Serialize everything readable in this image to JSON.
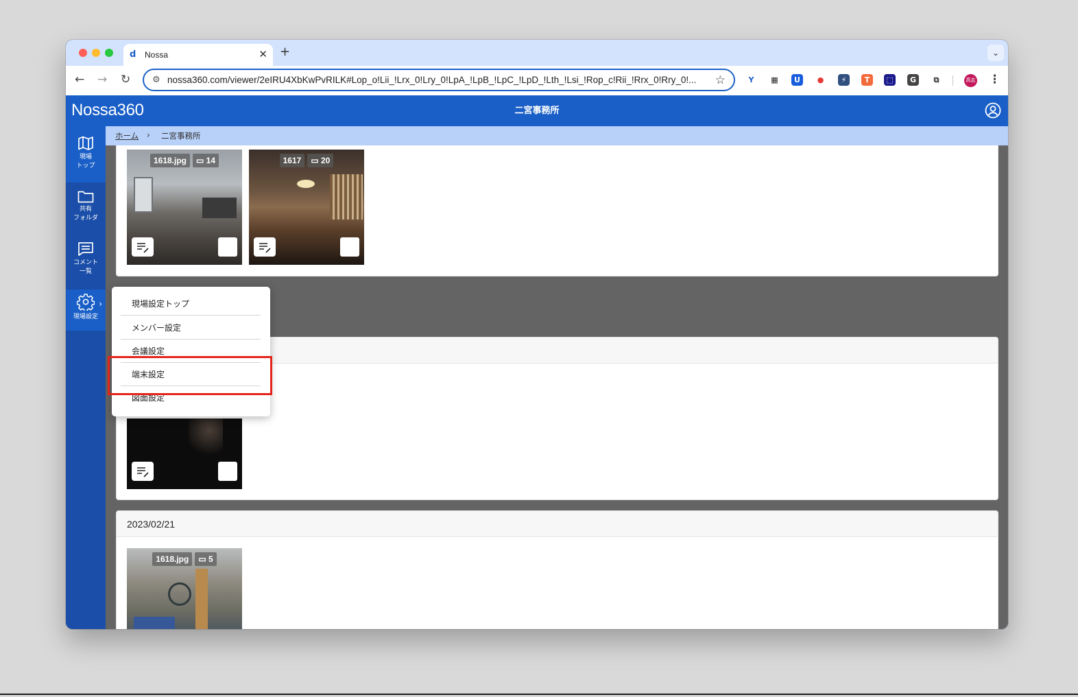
{
  "browser": {
    "tab_title": "Nossa",
    "tab_favicon": "d",
    "close_icon": "✕",
    "new_tab_icon": "+",
    "tab_dropdown_icon": "⌄",
    "back_icon": "←",
    "forward_icon": "→",
    "reload_icon": "↻",
    "site_info_icon": "⚙",
    "url": "nossa360.com/viewer/2eIRU4XbKwPvRILK#Lop_o!Lii_!Lrx_0!Lry_0!LpA_!LpB_!LpC_!LpD_!Lth_!Lsi_!Rop_c!Rii_!Rrx_0!Rry_0!...",
    "bookmark_icon": "☆",
    "profile_label": "高志",
    "menu_icon": "⋮",
    "extensions": [
      {
        "name": "y-extension-icon",
        "glyph": "Y",
        "color": "#1a5fc7",
        "bg": "#ffffff"
      },
      {
        "name": "qr-code-icon",
        "glyph": "▦",
        "color": "#222222",
        "bg": "#ffffff"
      },
      {
        "name": "bitwarden-icon",
        "glyph": "U",
        "color": "#ffffff",
        "bg": "#175ddc"
      },
      {
        "name": "record-icon",
        "glyph": "●",
        "color": "#e53935",
        "bg": "#ffffff"
      },
      {
        "name": "bolt-icon",
        "glyph": "⚡",
        "color": "#ffffff",
        "bg": "#2f4f7f"
      },
      {
        "name": "translate-icon",
        "glyph": "T",
        "color": "#ffffff",
        "bg": "#f26b3a"
      },
      {
        "name": "notion-like-icon",
        "glyph": "⬚",
        "color": "#ffffff",
        "bg": "#1a1a8c"
      },
      {
        "name": "g-extension-icon",
        "glyph": "G",
        "color": "#ffffff",
        "bg": "#444444"
      },
      {
        "name": "puzzle-icon",
        "glyph": "⧉",
        "color": "#333333",
        "bg": "#ffffff"
      }
    ]
  },
  "app": {
    "logo": "Nossa360",
    "site_title": "二宮事務所"
  },
  "sidebar": {
    "items": [
      {
        "label": "現場\nトップ"
      },
      {
        "label": "共有\nフォルダ"
      },
      {
        "label": "コメント\n一覧"
      },
      {
        "label": "現場設定",
        "chevron": "›"
      }
    ]
  },
  "breadcrumb": {
    "home": "ホーム",
    "separator": "›",
    "current": "二宮事務所"
  },
  "cards": [
    {
      "thumbs": [
        {
          "name": "1618.jpg",
          "count": "14"
        },
        {
          "name": "1617",
          "count": "20"
        }
      ]
    },
    {
      "thumbs": []
    },
    {
      "date": "2023/02/21",
      "thumbs": [
        {
          "name": "1618.jpg",
          "count": "5"
        }
      ]
    }
  ],
  "menu": {
    "items": [
      "現場設定トップ",
      "メンバー設定",
      "会議設定",
      "端末設定",
      "図面設定"
    ],
    "highlighted": "端末設定",
    "highlight_color": "#e3241b"
  },
  "colors": {
    "brand": "#1a5fc7",
    "sidebar": "#1a4ea8",
    "breadcrumb": "#b8d1f9"
  }
}
